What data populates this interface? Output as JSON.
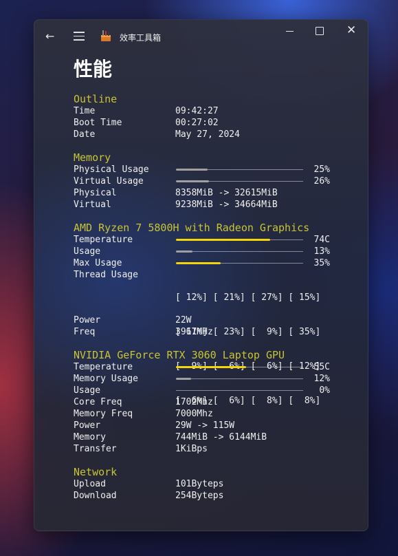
{
  "window": {
    "title": "效率工具箱"
  },
  "page": {
    "title": "性能"
  },
  "colors": {
    "accent_yellow": "#f3d60a",
    "section_title": "#c8c434",
    "gray_fill": "#a0a0a0"
  },
  "icons": {
    "back": "arrow-left-icon",
    "menu": "hamburger-icon",
    "app": "toolbox-icon",
    "close": "close-icon"
  },
  "outline": {
    "title": "Outline",
    "time_label": "Time",
    "time_value": "09:42:27",
    "boot_label": "Boot Time",
    "boot_value": "00:27:02",
    "date_label": "Date",
    "date_value": "May 27, 2024"
  },
  "memory": {
    "title": "Memory",
    "physical_usage_label": "Physical Usage",
    "physical_usage_pct": "25%",
    "physical_usage_level": 0.25,
    "virtual_usage_label": "Virtual Usage",
    "virtual_usage_pct": "26%",
    "virtual_usage_level": 0.26,
    "physical_label": "Physical",
    "physical_value": "8358MiB -> 32615MiB",
    "virtual_label": "Virtual",
    "virtual_value": "9238MiB -> 34664MiB"
  },
  "cpu": {
    "title": "AMD Ryzen 7 5800H with Radeon Graphics",
    "temp_label": "Temperature",
    "temp_value": "74C",
    "temp_level": 0.74,
    "usage_label": "Usage",
    "usage_value": "13%",
    "usage_level": 0.13,
    "max_label": "Max Usage",
    "max_value": "35%",
    "max_level": 0.35,
    "thread_label": "Thread Usage",
    "thread_rows": [
      "[ 12%] [ 21%] [ 27%] [ 15%]",
      "[ 11%] [ 23%] [  9%] [ 35%]",
      "[  9%] [  6%] [  6%] [ 12%]",
      "[  6%] [  6%] [  8%] [  8%]"
    ],
    "power_label": "Power",
    "power_value": "22W",
    "freq_label": "Freq",
    "freq_value": "3967MHz"
  },
  "gpu": {
    "title": "NVIDIA GeForce RTX 3060 Laptop GPU",
    "temp_label": "Temperature",
    "temp_value": "55C",
    "temp_level": 0.55,
    "mem_usage_label": "Memory Usage",
    "mem_usage_value": "12%",
    "mem_usage_level": 0.12,
    "usage_label": "Usage",
    "usage_value": "0%",
    "usage_level": 0.0,
    "core_freq_label": "Core Freq",
    "core_freq_value": "1702Mhz",
    "mem_freq_label": "Memory Freq",
    "mem_freq_value": "7000Mhz",
    "power_label": "Power",
    "power_value": "29W -> 115W",
    "memory_label": "Memory",
    "memory_value": "744MiB -> 6144MiB",
    "transfer_label": "Transfer",
    "transfer_value": "1KiBps"
  },
  "network": {
    "title": "Network",
    "upload_label": "Upload",
    "upload_value": "101Byteps",
    "download_label": "Download",
    "download_value": "254Byteps"
  }
}
